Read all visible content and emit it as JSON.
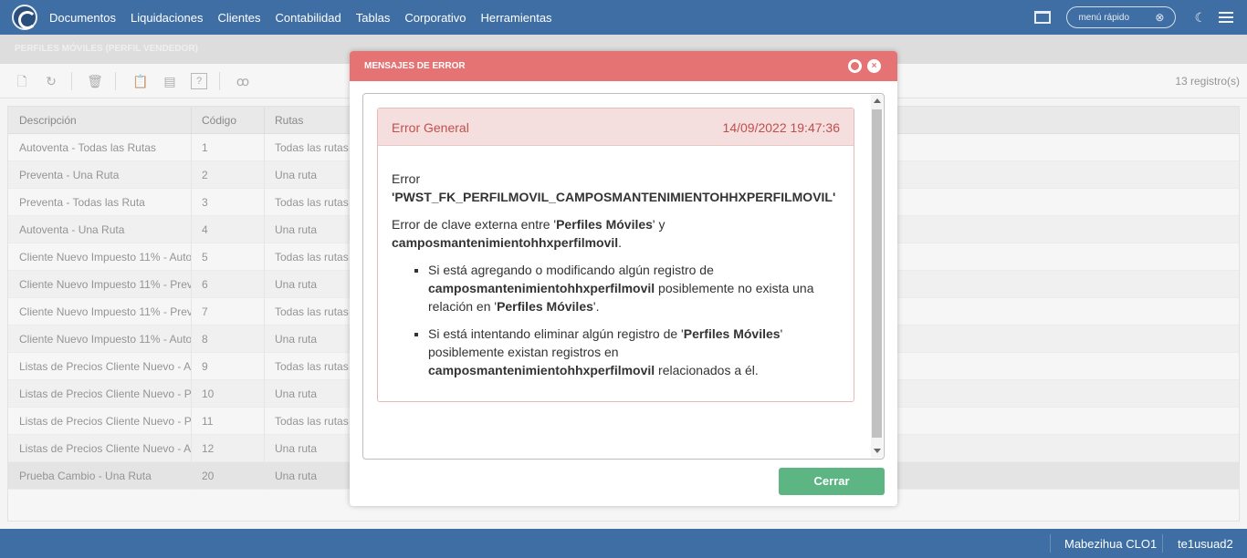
{
  "nav": {
    "items": [
      "Documentos",
      "Liquidaciones",
      "Clientes",
      "Contabilidad",
      "Tablas",
      "Corporativo",
      "Herramientas"
    ],
    "quick_menu_placeholder": "menú rápido"
  },
  "page": {
    "title": "PERFILES MÓVILES (PERFIL VENDEDOR)",
    "record_count": "13 registro(s)"
  },
  "table": {
    "columns": [
      "Descripción",
      "Código",
      "Rutas"
    ],
    "rows": [
      [
        "Autoventa - Todas las Rutas",
        "1",
        "Todas las rutas"
      ],
      [
        "Preventa - Una Ruta",
        "2",
        "Una ruta"
      ],
      [
        "Preventa - Todas las Ruta",
        "3",
        "Todas las rutas"
      ],
      [
        "Autoventa - Una Ruta",
        "4",
        "Una ruta"
      ],
      [
        "Cliente Nuevo Impuesto 11% - Auto",
        "5",
        "Todas las rutas"
      ],
      [
        "Cliente Nuevo Impuesto 11% - Prev",
        "6",
        "Una ruta"
      ],
      [
        "Cliente Nuevo Impuesto 11% - Prev",
        "7",
        "Todas las rutas"
      ],
      [
        "Cliente Nuevo Impuesto 11% - Auto",
        "8",
        "Una ruta"
      ],
      [
        "Listas de Precios Cliente Nuevo - Au",
        "9",
        "Todas las rutas"
      ],
      [
        "Listas de Precios Cliente Nuevo - Pr",
        "10",
        "Una ruta"
      ],
      [
        "Listas de Precios Cliente Nuevo - Pr",
        "11",
        "Todas las rutas"
      ],
      [
        "Listas de Precios Cliente Nuevo - Au",
        "12",
        "Una ruta"
      ],
      [
        "Prueba Cambio - Una Ruta",
        "20",
        "Una ruta"
      ]
    ]
  },
  "dialog": {
    "title": "MENSAJES DE ERROR",
    "card_title": "Error General",
    "card_date": "14/09/2022 19:47:36",
    "error_label": "Error",
    "error_code": "'PWST_FK_PERFILMOVIL_CAMPOSMANTENIMIENTOHHXPERFILMOVIL'",
    "p2_a": "Error de clave externa entre '",
    "p2_entity": "Perfiles Móviles",
    "p2_b": "' y",
    "p2_table": "camposmantenimientohhxperfilmovil",
    "p2_c": ".",
    "b1_a": "Si está agregando o modificando algún registro de",
    "b1_table": "camposmantenimientohhxperfilmovil",
    "b1_b": " posiblemente no exista una relación en '",
    "b1_entity": "Perfiles Móviles",
    "b1_c": "'.",
    "b2_a": "Si está intentando eliminar algún registro de '",
    "b2_entity": "Perfiles Móviles",
    "b2_b": "' posiblemente existan registros en",
    "b2_table": "camposmantenimientohhxperfilmovil",
    "b2_c": " relacionados a él.",
    "close_label": "Cerrar"
  },
  "status": {
    "company": "Mabezihua CLO1",
    "user": "te1usuad2"
  },
  "colors": {
    "nav_bg": "#3e6ea3",
    "dialog_header": "#e57373",
    "error_text": "#c0504d",
    "close_button": "#5cb583"
  }
}
